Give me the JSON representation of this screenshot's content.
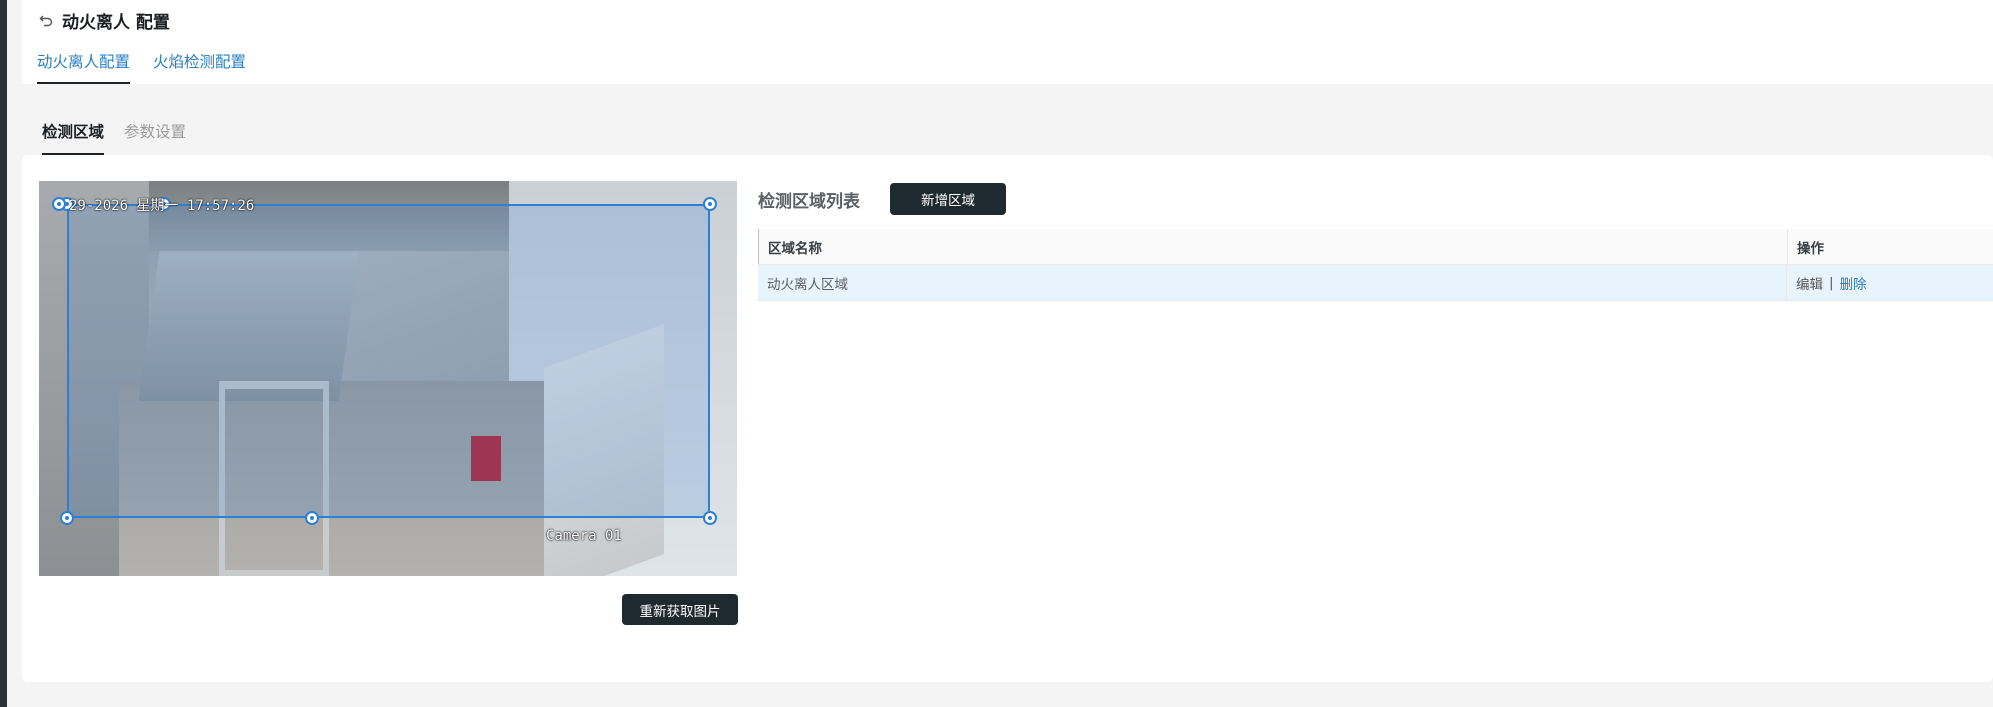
{
  "header": {
    "title": "动火离人 配置",
    "tabs": [
      {
        "label": "动火离人配置",
        "active": true
      },
      {
        "label": "火焰检测配置",
        "active": false
      }
    ]
  },
  "sub_tabs": [
    {
      "label": "检测区域",
      "active": true
    },
    {
      "label": "参数设置",
      "active": false
    }
  ],
  "camera": {
    "osd_datetime": "29-2026 星期一 17:57:26",
    "osd_camera": "Camera 01"
  },
  "refresh_button": "重新获取图片",
  "region_list": {
    "title": "检测区域列表",
    "add_button": "新增区域",
    "columns": [
      "区域名称",
      "操作"
    ],
    "rows": [
      {
        "name": "动火离人区域",
        "edit": "编辑",
        "separator": "|",
        "delete": "删除"
      }
    ]
  },
  "colors": {
    "accent": "#2b7fc1",
    "button_dark": "#1f2a30",
    "roi_stroke": "#2e7fd1",
    "row_highlight": "#e8f4fc"
  },
  "icons": {
    "back": "back-arrow-icon"
  }
}
